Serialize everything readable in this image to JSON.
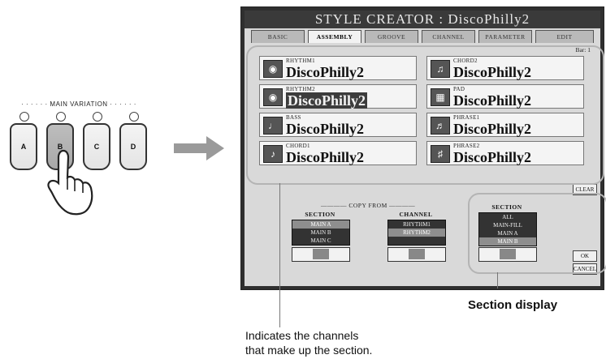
{
  "main_variation": {
    "title": "MAIN VARIATION",
    "buttons": [
      {
        "letter": "A",
        "active": false
      },
      {
        "letter": "B",
        "active": true
      },
      {
        "letter": "C",
        "active": false
      },
      {
        "letter": "D",
        "active": false
      }
    ]
  },
  "screen": {
    "title": "STYLE CREATOR : DiscoPhilly2",
    "tabs": [
      "BASIC",
      "ASSEMBLY",
      "GROOVE",
      "CHANNEL",
      "PARAMETER",
      "EDIT"
    ],
    "active_tab": "ASSEMBLY",
    "bar": "Bar:  1",
    "channels": [
      {
        "label": "RHYTHM1",
        "name": "DiscoPhilly2",
        "icon": "drum-kit-icon"
      },
      {
        "label": "CHORD2",
        "name": "DiscoPhilly2",
        "icon": "piano-icon"
      },
      {
        "label": "RHYTHM2",
        "name": "DiscoPhilly2",
        "icon": "drum-kit-icon"
      },
      {
        "label": "PAD",
        "name": "DiscoPhilly2",
        "icon": "organ-icon"
      },
      {
        "label": "BASS",
        "name": "DiscoPhilly2",
        "icon": "bass-icon"
      },
      {
        "label": "PHRASE1",
        "name": "DiscoPhilly2",
        "icon": "brass-icon"
      },
      {
        "label": "CHORD1",
        "name": "DiscoPhilly2",
        "icon": "guitar-icon"
      },
      {
        "label": "PHRASE2",
        "name": "DiscoPhilly2",
        "icon": "strings-icon"
      }
    ],
    "side_buttons": {
      "clear": "CLEAR",
      "ok": "OK",
      "cancel": "CANCEL"
    },
    "copy_from": {
      "title": "COPY FROM",
      "section_label": "SECTION",
      "section_items": [
        "MAIN A",
        "MAIN B",
        "MAIN C"
      ],
      "channel_label": "CHANNEL",
      "channel_items": [
        "RHYTHM1",
        "RHYTHM2"
      ]
    },
    "section": {
      "label": "SECTION",
      "items": [
        "ALL",
        "MAIN-FILL",
        "MAIN A",
        "MAIN B"
      ]
    }
  },
  "callouts": {
    "section_display": "Section display",
    "channels_note_line1": "Indicates the channels",
    "channels_note_line2": "that make up the section."
  },
  "colors": {
    "screen_frame": "#2f2f2f",
    "screen_bg": "#d9d9d9",
    "highlight_oval": "#b4b4b4"
  }
}
